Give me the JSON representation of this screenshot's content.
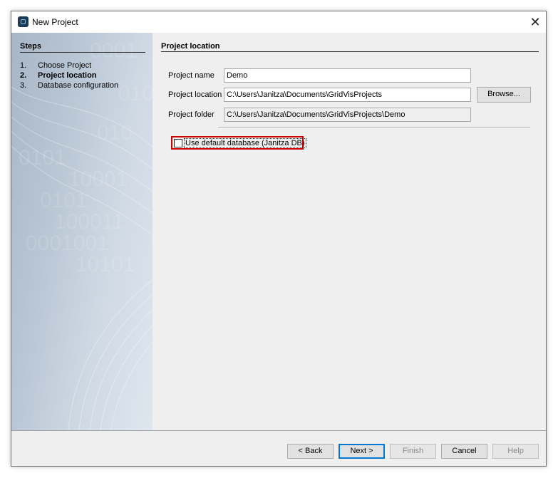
{
  "window": {
    "title": "New Project",
    "close_glyph": "✕"
  },
  "steps": {
    "title": "Steps",
    "items": [
      {
        "num": "1.",
        "label": "Choose Project",
        "active": false
      },
      {
        "num": "2.",
        "label": "Project location",
        "active": true
      },
      {
        "num": "3.",
        "label": "Database configuration",
        "active": false
      }
    ]
  },
  "page": {
    "title": "Project location",
    "project_name_label": "Project name",
    "project_name_value": "Demo",
    "project_location_label": "Project location",
    "project_location_value": "C:\\Users\\Janitza\\Documents\\GridVisProjects",
    "browse_label": "Browse...",
    "project_folder_label": "Project folder",
    "project_folder_value": "C:\\Users\\Janitza\\Documents\\GridVisProjects\\Demo",
    "default_db_label": "Use default database (Janitza DB)",
    "default_db_checked": false
  },
  "footer": {
    "back_label": "< Back",
    "next_label": "Next >",
    "finish_label": "Finish",
    "cancel_label": "Cancel",
    "help_label": "Help"
  },
  "colors": {
    "highlight": "#d20000",
    "default_button_border": "#0078d7",
    "panel_background": "#a7b6c7"
  },
  "icons": {
    "app": "gridvis-app-icon",
    "close": "close-icon"
  }
}
